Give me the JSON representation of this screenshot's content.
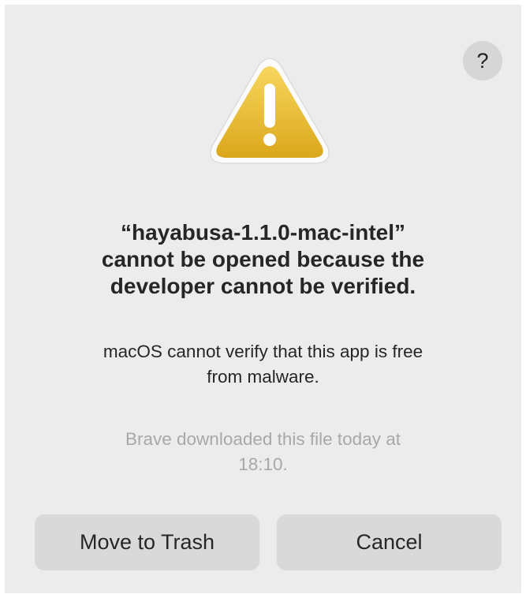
{
  "dialog": {
    "help_label": "?",
    "warning_icon": "warning-triangle-icon",
    "warning_mark": "!",
    "title_lines": [
      "“hayabusa-1.1.0-mac-intel”",
      "cannot be opened because the",
      "developer cannot be verified."
    ],
    "message_lines": [
      "macOS cannot verify that this app is free",
      "from malware."
    ],
    "source_lines": [
      "Brave downloaded this file today at",
      "18:10."
    ],
    "buttons": {
      "move_to_trash": "Move to Trash",
      "cancel": "Cancel"
    }
  },
  "colors": {
    "dialog_bg": "#ececec",
    "button_bg": "#d9d9d9",
    "warning_yellow_top": "#f7d25a",
    "warning_yellow_bottom": "#dcaa1e",
    "secondary_text": "#a8a8a8"
  }
}
